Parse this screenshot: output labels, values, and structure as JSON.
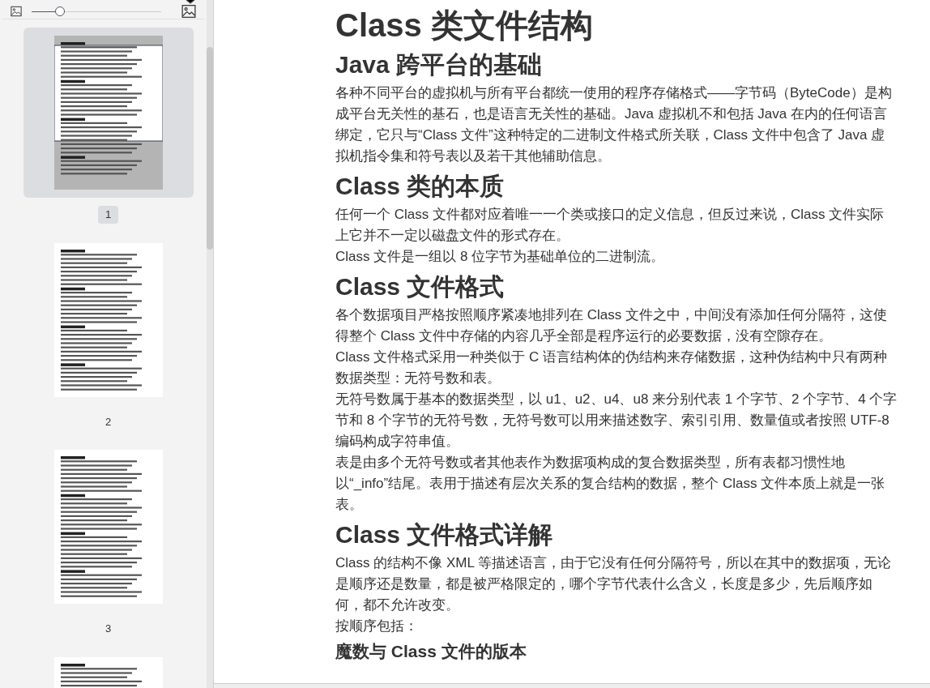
{
  "sidebar": {
    "zoom_slider": {
      "level": 0.22
    },
    "thumbnails": [
      {
        "page": "1",
        "selected": true
      },
      {
        "page": "2",
        "selected": false
      },
      {
        "page": "3",
        "selected": false
      },
      {
        "selected": false
      }
    ]
  },
  "document": {
    "title": "Class 类文件结构",
    "blocks": [
      {
        "kind": "heading",
        "text": "Java 跨平台的基础"
      },
      {
        "kind": "paragraph",
        "text": "各种不同平台的虚拟机与所有平台都统一使用的程序存储格式——字节码（ByteCode）是构成平台无关性的基石，也是语言无关性的基础。Java 虚拟机不和包括 Java 在内的任何语言绑定，它只与“Class 文件”这种特定的二进制文件格式所关联，Class 文件中包含了 Java 虚拟机指令集和符号表以及若干其他辅助信息。"
      },
      {
        "kind": "heading",
        "text": "Class 类的本质"
      },
      {
        "kind": "paragraph",
        "text": "任何一个 Class 文件都对应着唯一一个类或接口的定义信息，但反过来说，Class 文件实际上它并不一定以磁盘文件的形式存在。"
      },
      {
        "kind": "paragraph",
        "text": "Class 文件是一组以 8 位字节为基础单位的二进制流。"
      },
      {
        "kind": "heading",
        "text": "Class 文件格式"
      },
      {
        "kind": "paragraph",
        "text": "各个数据项目严格按照顺序紧凑地排列在 Class 文件之中，中间没有添加任何分隔符，这使得整个 Class 文件中存储的内容几乎全部是程序运行的必要数据，没有空隙存在。"
      },
      {
        "kind": "paragraph",
        "text": "Class 文件格式采用一种类似于 C 语言结构体的伪结构来存储数据，这种伪结构中只有两种数据类型：无符号数和表。"
      },
      {
        "kind": "paragraph",
        "text": "无符号数属于基本的数据类型，以 u1、u2、u4、u8 来分别代表 1 个字节、2 个字节、4 个字节和 8 个字节的无符号数，无符号数可以用来描述数字、索引引用、数量值或者按照 UTF-8 编码构成字符串值。"
      },
      {
        "kind": "paragraph",
        "text": "表是由多个无符号数或者其他表作为数据项构成的复合数据类型，所有表都习惯性地以“_info”结尾。表用于描述有层次关系的复合结构的数据，整个 Class 文件本质上就是一张表。"
      },
      {
        "kind": "heading",
        "text": "Class 文件格式详解"
      },
      {
        "kind": "paragraph",
        "text": "Class 的结构不像 XML 等描述语言，由于它没有任何分隔符号，所以在其中的数据项，无论是顺序还是数量，都是被严格限定的，哪个字节代表什么含义，长度是多少，先后顺序如何，都不允许改变。"
      },
      {
        "kind": "paragraph",
        "text": "按顺序包括："
      },
      {
        "kind": "subheading",
        "text": "魔数与 Class 文件的版本"
      }
    ]
  }
}
